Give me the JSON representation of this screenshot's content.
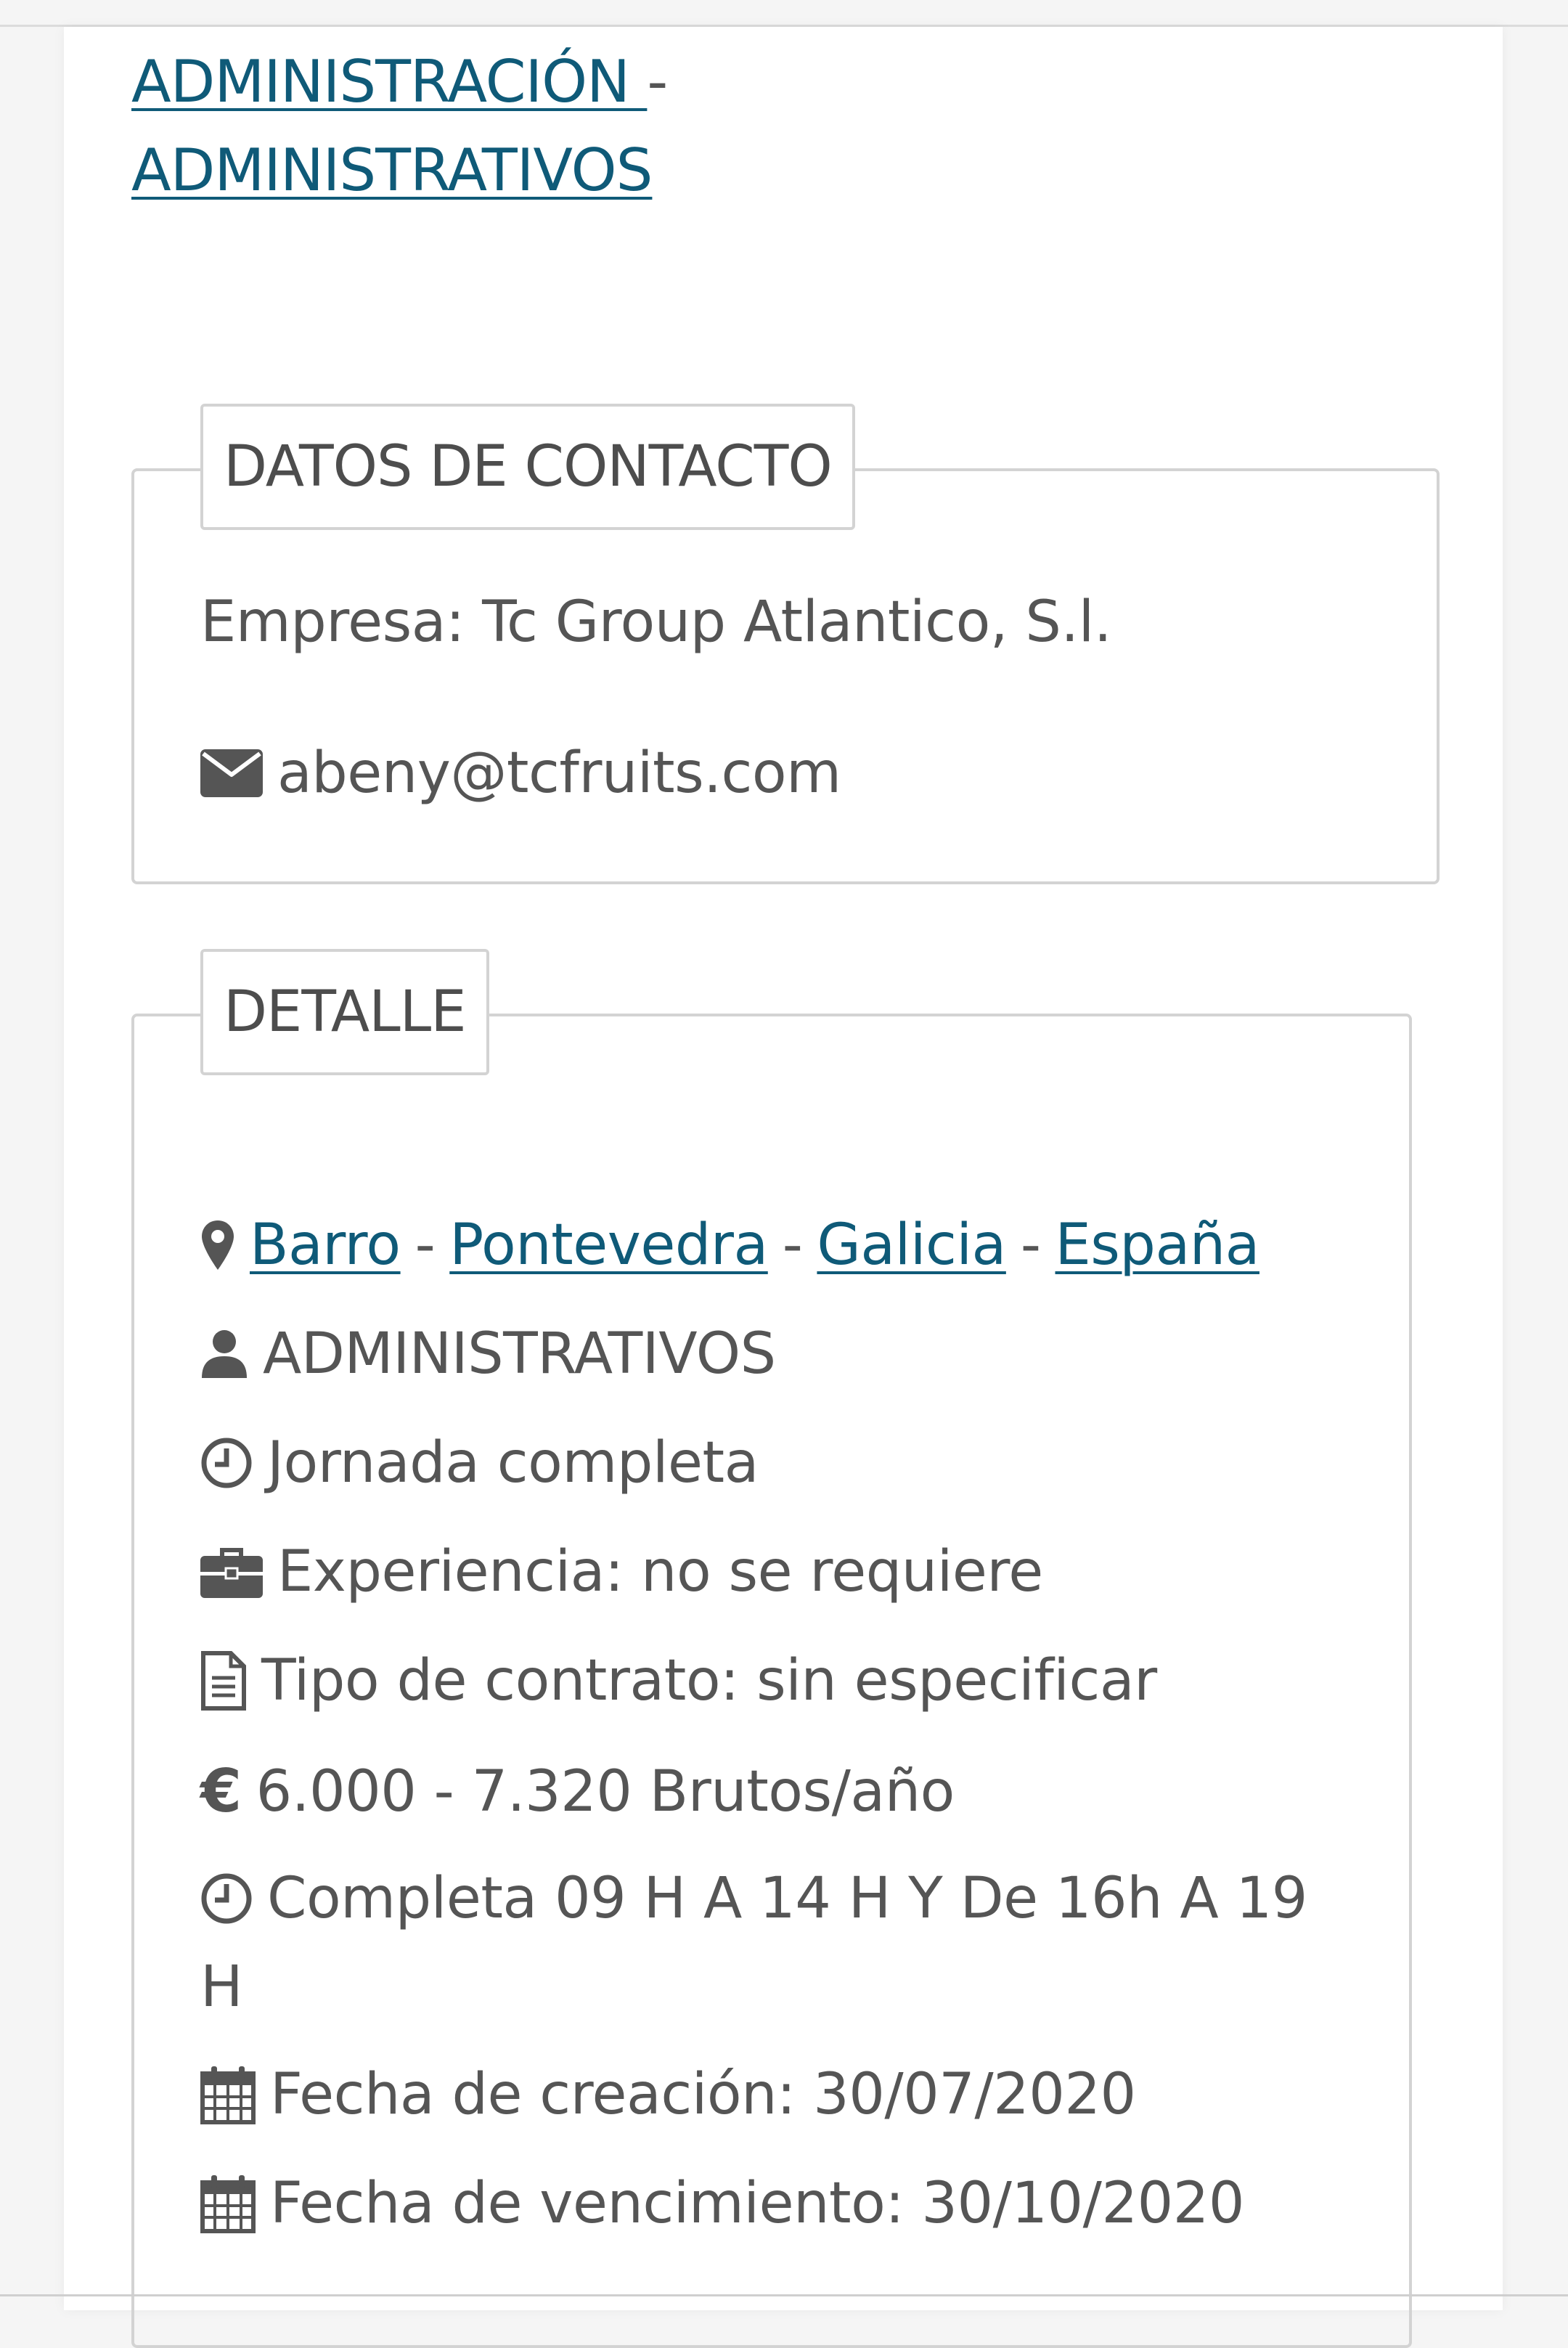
{
  "category": {
    "link1": "ADMINISTRACIÓN ",
    "separator": "-",
    "link2": "ADMINISTRATIVOS"
  },
  "contact": {
    "legend": "DATOS DE CONTACTO",
    "company": "Empresa: Tc Group Atlantico, S.l.",
    "email": "abeny@tcfruits.com"
  },
  "detail": {
    "legend": "DETALLE",
    "location": {
      "city": "Barro",
      "province": "Pontevedra",
      "region": "Galicia",
      "country": "España",
      "separator": "-"
    },
    "category": "ADMINISTRATIVOS",
    "workday": "Jornada completa",
    "experience": "Experiencia: no se requiere",
    "contract": "Tipo de contrato: sin especificar",
    "salary": "6.000 - 7.320 Brutos/año",
    "schedule_line1": "Completa 09 H A 14 H Y De 16h A 19",
    "schedule_line2": "H",
    "created": "Fecha de creación: 30/07/2020",
    "expires": "Fecha de vencimiento: 30/10/2020"
  },
  "icons": {
    "email": "envelope-icon",
    "location": "map-marker-icon",
    "category": "user-icon",
    "workday": "clock-icon",
    "experience": "briefcase-icon",
    "contract": "document-icon",
    "salary": "euro-icon",
    "schedule": "clock-icon",
    "created": "calendar-icon",
    "expires": "calendar-icon"
  },
  "colors": {
    "link": "#0f5a78",
    "text": "#555555",
    "border": "#d3d3d3"
  }
}
